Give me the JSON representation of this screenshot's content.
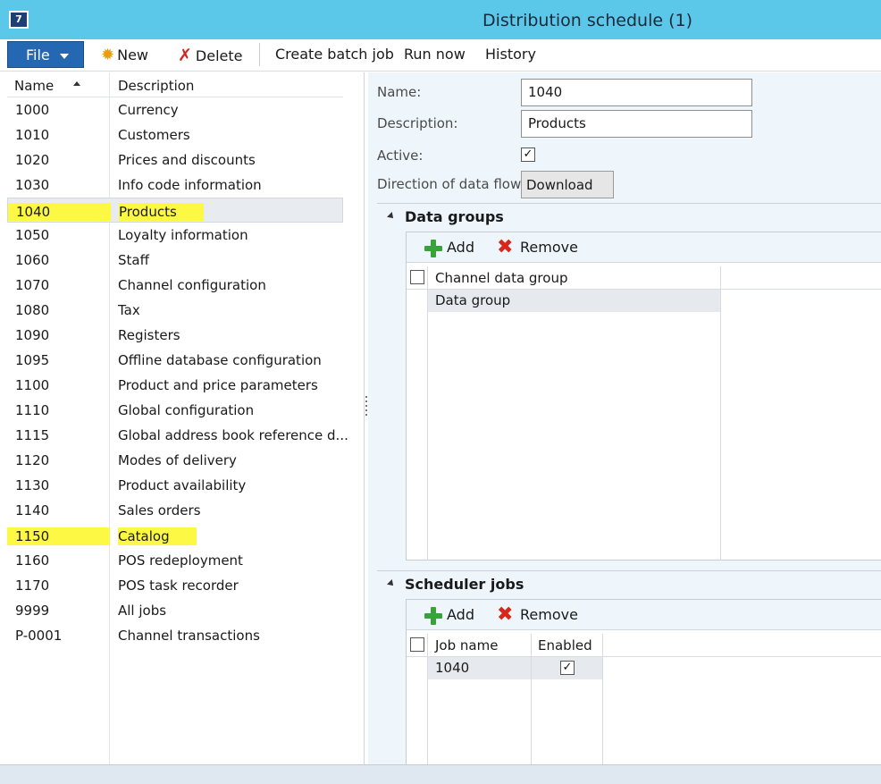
{
  "window": {
    "icon": "app-logo-icon",
    "title": "Distribution schedule (1)"
  },
  "toolbar": {
    "file_label": "File",
    "new_label": "New",
    "delete_label": "Delete",
    "create_batch_label": "Create batch job",
    "run_now_label": "Run now",
    "history_label": "History"
  },
  "list": {
    "col_name": "Name",
    "col_description": "Description",
    "rows": [
      {
        "name": "1000",
        "description": "Currency"
      },
      {
        "name": "1010",
        "description": "Customers"
      },
      {
        "name": "1020",
        "description": "Prices and discounts"
      },
      {
        "name": "1030",
        "description": "Info code information"
      },
      {
        "name": "1040",
        "description": "Products"
      },
      {
        "name": "1050",
        "description": "Loyalty information"
      },
      {
        "name": "1060",
        "description": "Staff"
      },
      {
        "name": "1070",
        "description": "Channel configuration"
      },
      {
        "name": "1080",
        "description": "Tax"
      },
      {
        "name": "1090",
        "description": "Registers"
      },
      {
        "name": "1095",
        "description": "Offline database configuration"
      },
      {
        "name": "1100",
        "description": "Product and price parameters"
      },
      {
        "name": "1110",
        "description": "Global configuration"
      },
      {
        "name": "1115",
        "description": "Global address book reference d..."
      },
      {
        "name": "1120",
        "description": "Modes of delivery"
      },
      {
        "name": "1130",
        "description": "Product availability"
      },
      {
        "name": "1140",
        "description": "Sales orders"
      },
      {
        "name": "1150",
        "description": "Catalog"
      },
      {
        "name": "1160",
        "description": "POS redeployment"
      },
      {
        "name": "1170",
        "description": "POS task recorder"
      },
      {
        "name": "9999",
        "description": "All jobs"
      },
      {
        "name": "P-0001",
        "description": "Channel transactions"
      }
    ]
  },
  "detail": {
    "name_label": "Name:",
    "name_value": "1040",
    "description_label": "Description:",
    "description_value": "Products",
    "active_label": "Active:",
    "active_checked": "✓",
    "direction_label": "Direction of data flow:",
    "direction_value": "Download"
  },
  "data_groups": {
    "title": "Data groups",
    "add_label": "Add",
    "remove_label": "Remove",
    "col_channel_data_group": "Channel data group",
    "row_value": "Data group"
  },
  "scheduler_jobs": {
    "title": "Scheduler jobs",
    "add_label": "Add",
    "remove_label": "Remove",
    "col_job_name": "Job name",
    "col_enabled": "Enabled",
    "row_job_name": "1040",
    "row_enabled": "✓"
  },
  "colors": {
    "titlebar": "#5bc8ea",
    "file_button": "#2468b4",
    "highlight": "#fdf844",
    "detail_background": "#eef6fc"
  }
}
